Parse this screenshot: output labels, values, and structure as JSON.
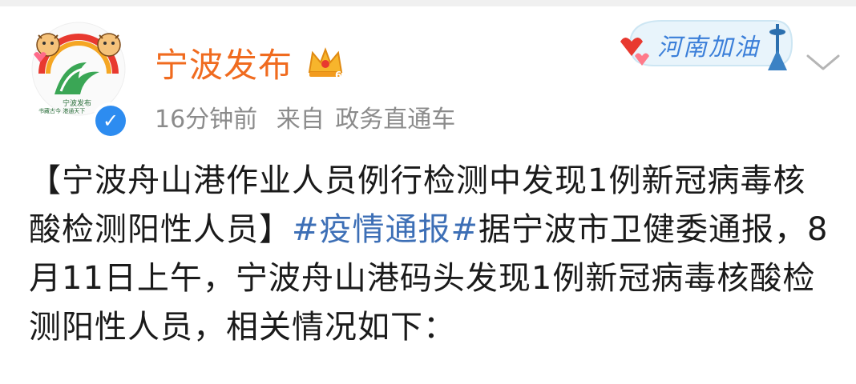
{
  "account": {
    "name": "宁波发布",
    "avatar_caption": "宁波发布",
    "avatar_motto": "书藏古今 港通天下"
  },
  "post": {
    "time": "16分钟前",
    "via_label": "来自",
    "client": "政务直通车",
    "title": "【宁波舟山港作业人员例行检测中发现1例新冠病毒核酸检测阳性人员】",
    "hashtag": "#疫情通报#",
    "body": "据宁波市卫健委通报，8月11日上午，宁波舟山港码头发现1例新冠病毒核酸检测阳性人员，相关情况如下："
  },
  "sticker": {
    "text": "河南加油"
  },
  "icons": {
    "verified": "verified-badge-icon",
    "crown": "crown-badge-icon",
    "more": "chevron-down-icon"
  },
  "colors": {
    "name": "#f06b1f",
    "meta": "#8b8b8b",
    "hashtag": "#3d6fb6",
    "verified": "#2d8cf0",
    "text": "#1a1a1a"
  }
}
